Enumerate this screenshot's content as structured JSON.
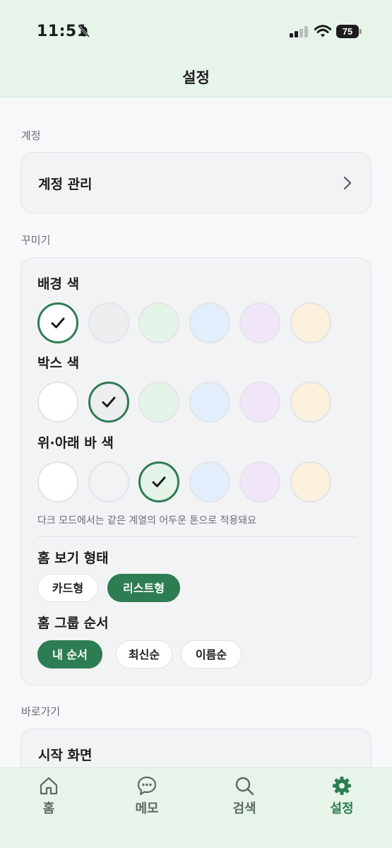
{
  "status_bar": {
    "time": "11:51",
    "battery": "75",
    "icons": [
      "bell-slash-icon",
      "signal-icon",
      "wifi-icon",
      "battery-icon"
    ]
  },
  "header": {
    "title": "설정"
  },
  "account": {
    "section_label": "계정",
    "row_label": "계정 관리",
    "chevron": "chevron-right-icon"
  },
  "customize": {
    "section_label": "꾸미기",
    "background_color": {
      "label": "배경 색",
      "swatches": [
        "#ffffff",
        "#eceef0",
        "#e5f4e8",
        "#e2eefb",
        "#f0e6f8",
        "#fbf1dd"
      ],
      "selected_index": 0
    },
    "box_color": {
      "label": "박스 색",
      "swatches": [
        "#ffffff",
        "#eceef0",
        "#e5f4e8",
        "#e2eefb",
        "#f0e6f8",
        "#fbf1dd"
      ],
      "selected_index": 1
    },
    "bar_color": {
      "label": "위·아래 바 색",
      "swatches": [
        "#ffffff",
        "#f2f3f5",
        "#e5f4e8",
        "#e2eefb",
        "#f0e6f8",
        "#fbf1dd"
      ],
      "selected_index": 2
    },
    "dark_mode_hint": "다크 모드에서는 같은 계열의 어두운 톤으로 적용돼요",
    "home_view": {
      "label": "홈 보기 형태",
      "options": [
        "카드형",
        "리스트형"
      ],
      "selected": "리스트형"
    },
    "group_order": {
      "label": "홈 그룹 순서",
      "options": [
        "내 순서",
        "최신순",
        "이름순"
      ],
      "selected": "내 순서"
    }
  },
  "shortcuts": {
    "section_label": "바로가기",
    "row_label": "시작 화면"
  },
  "tabs": [
    {
      "label": "홈",
      "icon": "home-icon",
      "active": false
    },
    {
      "label": "메모",
      "icon": "chat-bubble-icon",
      "active": false
    },
    {
      "label": "검색",
      "icon": "search-icon",
      "active": false
    },
    {
      "label": "설정",
      "icon": "gear-icon",
      "active": true
    }
  ],
  "colors": {
    "accent": "#2e7d52",
    "bar_background": "#e6f4ea",
    "page_background": "#f7f8fa"
  }
}
